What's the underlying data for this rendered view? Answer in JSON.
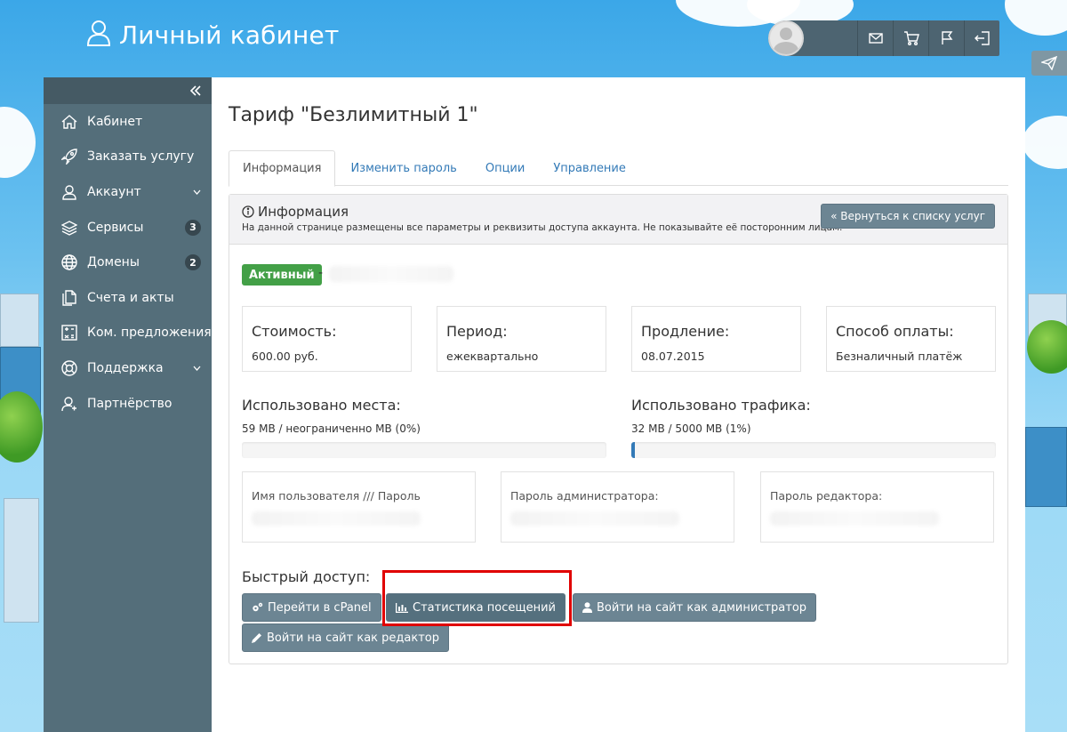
{
  "header": {
    "title": "Личный кабинет",
    "icons": [
      "user-outline-icon",
      "envelope-icon",
      "cart-icon",
      "flag-icon",
      "logout-icon",
      "paper-plane-icon"
    ]
  },
  "sidebar": {
    "collapse_icon": "double-chevron-left-icon",
    "items": [
      {
        "label": "Кабинет",
        "icon": "home-icon"
      },
      {
        "label": "Заказать услугу",
        "icon": "rocket-icon"
      },
      {
        "label": "Аккаунт",
        "icon": "user-icon",
        "has_submenu": true
      },
      {
        "label": "Сервисы",
        "icon": "layers-icon",
        "badge": "3"
      },
      {
        "label": "Домены",
        "icon": "globe-icon",
        "badge": "2"
      },
      {
        "label": "Счета и акты",
        "icon": "documents-icon"
      },
      {
        "label": "Ком. предложения",
        "icon": "calculator-icon"
      },
      {
        "label": "Поддержка",
        "icon": "lifebuoy-icon",
        "has_submenu": true
      },
      {
        "label": "Партнёрство",
        "icon": "partner-icon"
      }
    ]
  },
  "main": {
    "page_title": "Тариф \"Безлимитный 1\"",
    "tabs": [
      {
        "label": "Информация",
        "active": true
      },
      {
        "label": "Изменить пароль"
      },
      {
        "label": "Опции"
      },
      {
        "label": "Управление"
      }
    ],
    "panel": {
      "title": "Информация",
      "subtitle": "На данной странице размещены все параметры и реквизиты доступа аккаунта. Не показывайте её посторонним лицам.",
      "back_button": "« Вернуться к списку услуг"
    },
    "status": {
      "label": "Активный",
      "separator": "-"
    },
    "info": [
      {
        "label": "Стоимость:",
        "value": "600.00 руб."
      },
      {
        "label": "Период:",
        "value": "ежеквартально"
      },
      {
        "label": "Продление:",
        "value": "08.07.2015"
      },
      {
        "label": "Способ оплаты:",
        "value": "Безналичный платёж"
      }
    ],
    "usage": {
      "disk": {
        "label": "Использовано места:",
        "value": "59 MB / неограниченно MB (0%)",
        "percent": 0
      },
      "traffic": {
        "label": "Использовано трафика:",
        "value": "32 MB / 5000 MB (1%)",
        "percent": 1
      }
    },
    "credentials": [
      {
        "label": "Имя пользователя /// Пароль"
      },
      {
        "label": "Пароль администратора:"
      },
      {
        "label": "Пароль редактора:"
      }
    ],
    "quick_access": {
      "title": "Быстрый доступ:",
      "buttons": [
        {
          "label": "Перейти в cPanel",
          "icon": "gears-icon"
        },
        {
          "label": "Статистика посещений",
          "icon": "bar-chart-icon"
        },
        {
          "label": "Войти на сайт как администратор",
          "icon": "user-icon"
        },
        {
          "label": "Войти на сайт как редактор",
          "icon": "pencil-icon"
        }
      ]
    }
  },
  "colors": {
    "sidebar": "#546e7a",
    "button": "#6c8593",
    "active_label": "#43a047",
    "link": "#337ab7",
    "highlight": "#e00000"
  }
}
